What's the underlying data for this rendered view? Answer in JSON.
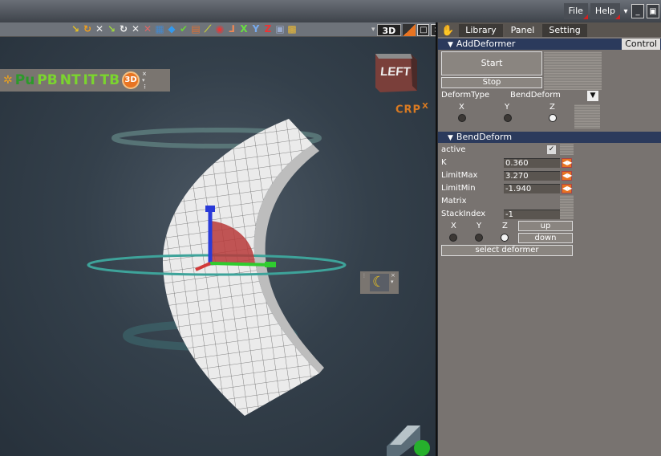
{
  "menu": {
    "file": "File",
    "help": "Help"
  },
  "viewport": {
    "tab_label": "3D",
    "left_toolbar": [
      "Pu",
      "PB",
      "NT",
      "IT",
      "TB"
    ],
    "viewcube_label": "LEFT",
    "crp_label": "CRP",
    "axis_x_label": "X"
  },
  "panel": {
    "tabs": [
      "Library",
      "Panel",
      "Setting"
    ],
    "add_deformer": {
      "title": "AddDeformer",
      "control_label": "Control",
      "start_label": "Start",
      "stop_label": "Stop",
      "deform_type_label": "DeformType",
      "deform_type_value": "BendDeform",
      "axes": [
        "X",
        "Y",
        "Z"
      ]
    },
    "bend_deform": {
      "title": "BendDeform",
      "active_label": "active",
      "rows": [
        {
          "label": "K",
          "value": "0.360"
        },
        {
          "label": "LimitMax",
          "value": "3.270"
        },
        {
          "label": "LimitMin",
          "value": "-1.940"
        }
      ],
      "matrix_label": "Matrix",
      "stack_index_label": "StackIndex",
      "stack_index_value": "-1",
      "axes": [
        "X",
        "Y",
        "Z"
      ],
      "up_label": "up",
      "down_label": "down",
      "select_label": "select deformer"
    }
  }
}
